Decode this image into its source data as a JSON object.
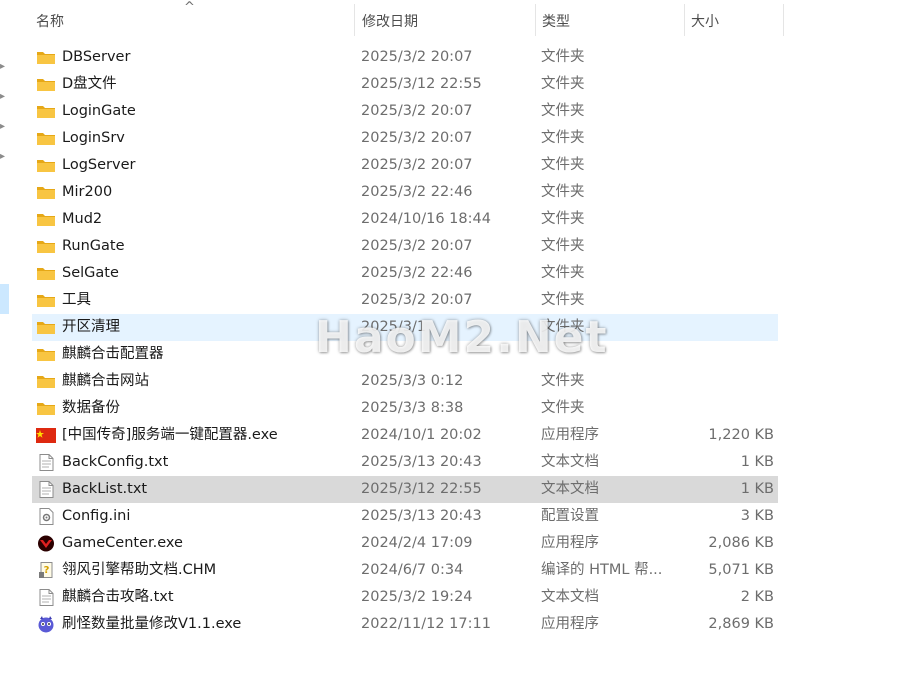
{
  "header": {
    "col_name": "名称",
    "col_date": "修改日期",
    "col_type": "类型",
    "col_size": "大小",
    "sort_indicator": "^"
  },
  "watermark": "HaoM2.Net",
  "files": [
    {
      "name": "DBServer",
      "date": "2025/3/2 20:07",
      "type": "文件夹",
      "size": "",
      "icon": "folder-icon"
    },
    {
      "name": "D盘文件",
      "date": "2025/3/12 22:55",
      "type": "文件夹",
      "size": "",
      "icon": "folder-icon"
    },
    {
      "name": "LoginGate",
      "date": "2025/3/2 20:07",
      "type": "文件夹",
      "size": "",
      "icon": "folder-icon"
    },
    {
      "name": "LoginSrv",
      "date": "2025/3/2 20:07",
      "type": "文件夹",
      "size": "",
      "icon": "folder-icon"
    },
    {
      "name": "LogServer",
      "date": "2025/3/2 20:07",
      "type": "文件夹",
      "size": "",
      "icon": "folder-icon"
    },
    {
      "name": "Mir200",
      "date": "2025/3/2 22:46",
      "type": "文件夹",
      "size": "",
      "icon": "folder-icon"
    },
    {
      "name": "Mud2",
      "date": "2024/10/16 18:44",
      "type": "文件夹",
      "size": "",
      "icon": "folder-icon"
    },
    {
      "name": "RunGate",
      "date": "2025/3/2 20:07",
      "type": "文件夹",
      "size": "",
      "icon": "folder-icon"
    },
    {
      "name": "SelGate",
      "date": "2025/3/2 22:46",
      "type": "文件夹",
      "size": "",
      "icon": "folder-icon"
    },
    {
      "name": "工具",
      "date": "2025/3/2 20:07",
      "type": "文件夹",
      "size": "",
      "icon": "folder-icon"
    },
    {
      "name": "开区清理",
      "date": "2025/3/1",
      "type": "文件夹",
      "size": "",
      "icon": "folder-icon"
    },
    {
      "name": "麒麟合击配置器",
      "date": "",
      "type": "",
      "size": "",
      "icon": "folder-icon"
    },
    {
      "name": "麒麟合击网站",
      "date": "2025/3/3 0:12",
      "type": "文件夹",
      "size": "",
      "icon": "folder-icon"
    },
    {
      "name": "数据备份",
      "date": "2025/3/3 8:38",
      "type": "文件夹",
      "size": "",
      "icon": "folder-icon"
    },
    {
      "name": "[中国传奇]服务端一键配置器.exe",
      "date": "2024/10/1 20:02",
      "type": "应用程序",
      "size": "1,220 KB",
      "icon": "china-flag-app-icon"
    },
    {
      "name": "BackConfig.txt",
      "date": "2025/3/13 20:43",
      "type": "文本文档",
      "size": "1 KB",
      "icon": "text-file-icon"
    },
    {
      "name": "BackList.txt",
      "date": "2025/3/12 22:55",
      "type": "文本文档",
      "size": "1 KB",
      "icon": "text-file-icon"
    },
    {
      "name": "Config.ini",
      "date": "2025/3/13 20:43",
      "type": "配置设置",
      "size": "3 KB",
      "icon": "config-file-icon"
    },
    {
      "name": "GameCenter.exe",
      "date": "2024/2/4 17:09",
      "type": "应用程序",
      "size": "2,086 KB",
      "icon": "game-app-icon"
    },
    {
      "name": "翎风引擎帮助文档.CHM",
      "date": "2024/6/7 0:34",
      "type": "编译的 HTML 帮...",
      "size": "5,071 KB",
      "icon": "chm-help-icon"
    },
    {
      "name": "麒麟合击攻略.txt",
      "date": "2025/3/2 19:24",
      "type": "文本文档",
      "size": "2 KB",
      "icon": "text-file-icon"
    },
    {
      "name": "刷怪数量批量修改V1.1.exe",
      "date": "2022/11/12 17:11",
      "type": "应用程序",
      "size": "2,869 KB",
      "icon": "mascot-app-icon"
    }
  ],
  "row_states": {
    "hover_index": 10,
    "selected_index": 16
  },
  "colors": {
    "hover": "#e5f3ff",
    "selected": "#d9d9d9",
    "folder": "#f8c542",
    "folder_dark": "#e6a817"
  }
}
